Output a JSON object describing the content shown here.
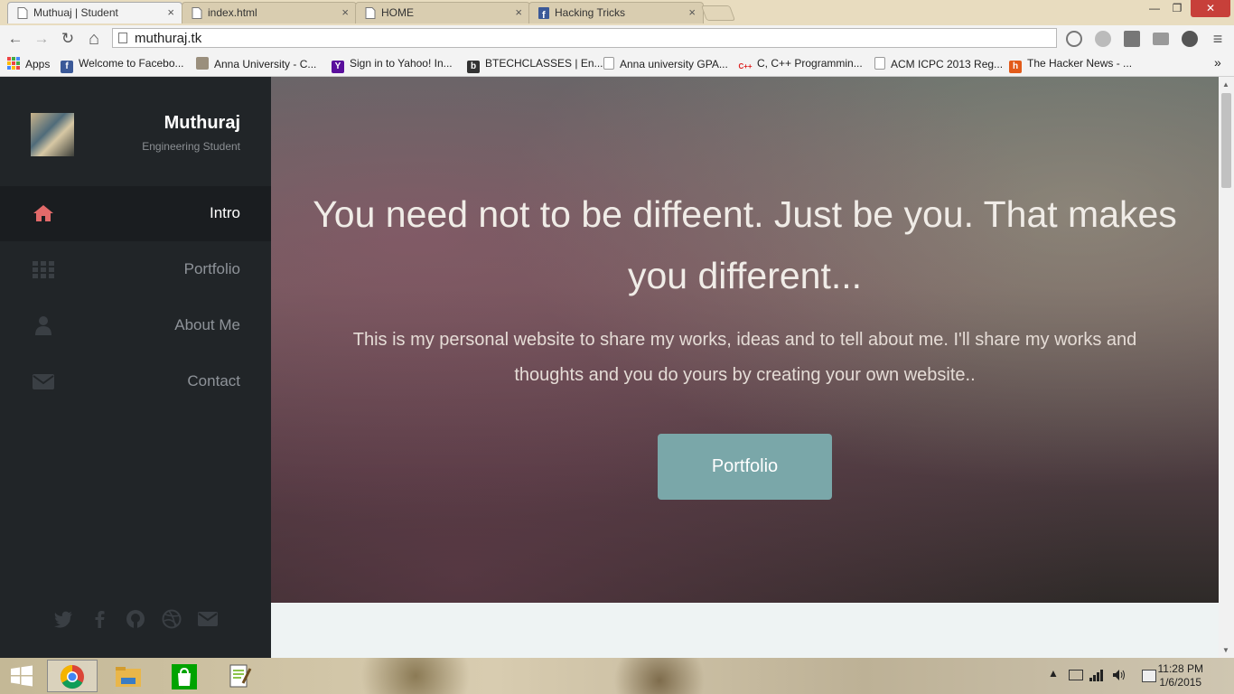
{
  "browser": {
    "tabs": [
      {
        "title": "Muthuaj | Student",
        "close": "×"
      },
      {
        "title": "index.html",
        "close": "×"
      },
      {
        "title": "HOME",
        "close": "×"
      },
      {
        "title": "Hacking Tricks",
        "close": "×"
      }
    ],
    "window_buttons": {
      "minimize": "—",
      "restore": "❐",
      "close": "✕"
    },
    "nav": {
      "back": "←",
      "forward": "→",
      "reload": "↻",
      "home": "⌂"
    },
    "url": "muthuraj.tk",
    "menu": "≡",
    "bookmarks": [
      {
        "label": "Apps",
        "icon": "apps-grid-icon"
      },
      {
        "label": "Welcome to Facebo...",
        "icon": "facebook-icon"
      },
      {
        "label": "Anna University - C...",
        "icon": "anna-university-icon"
      },
      {
        "label": "Sign in to Yahoo! In...",
        "icon": "yahoo-icon"
      },
      {
        "label": "BTECHCLASSES | En...",
        "icon": "btechclasses-icon"
      },
      {
        "label": "Anna university GPA...",
        "icon": "page-icon"
      },
      {
        "label": "C, C++ Programmin...",
        "icon": "cpp-icon"
      },
      {
        "label": "ACM ICPC 2013 Reg...",
        "icon": "page-icon"
      },
      {
        "label": "The Hacker News - ...",
        "icon": "hackernews-icon"
      }
    ],
    "bookmarks_overflow": "»"
  },
  "site": {
    "profile": {
      "name": "Muthuraj",
      "role": "Engineering Student"
    },
    "nav": [
      {
        "label": "Intro",
        "icon": "home-icon",
        "active": true
      },
      {
        "label": "Portfolio",
        "icon": "grid-icon",
        "active": false
      },
      {
        "label": "About Me",
        "icon": "user-icon",
        "active": false
      },
      {
        "label": "Contact",
        "icon": "envelope-icon",
        "active": false
      }
    ],
    "social": [
      "twitter-icon",
      "facebook-icon",
      "github-icon",
      "dribbble-icon",
      "envelope-icon"
    ],
    "hero": {
      "headline": "You need not to be diffeent. Just be you. That makes you different...",
      "subtext": "This is my personal website to share my works, ideas and to tell about me. I'll share my works and thoughts and you do yours by creating your own website..",
      "button": "Portfolio"
    },
    "colors": {
      "sidebar": "#212528",
      "active_nav": "#1a1d20",
      "active_icon": "#e26a6a",
      "accent_button": "#7aa7a9"
    }
  },
  "taskbar": {
    "apps": [
      "windows-start-icon",
      "chrome-icon",
      "file-explorer-icon",
      "windows-store-icon",
      "notepad-plus-plus-icon"
    ],
    "time": "11:28 PM",
    "date": "1/6/2015"
  }
}
